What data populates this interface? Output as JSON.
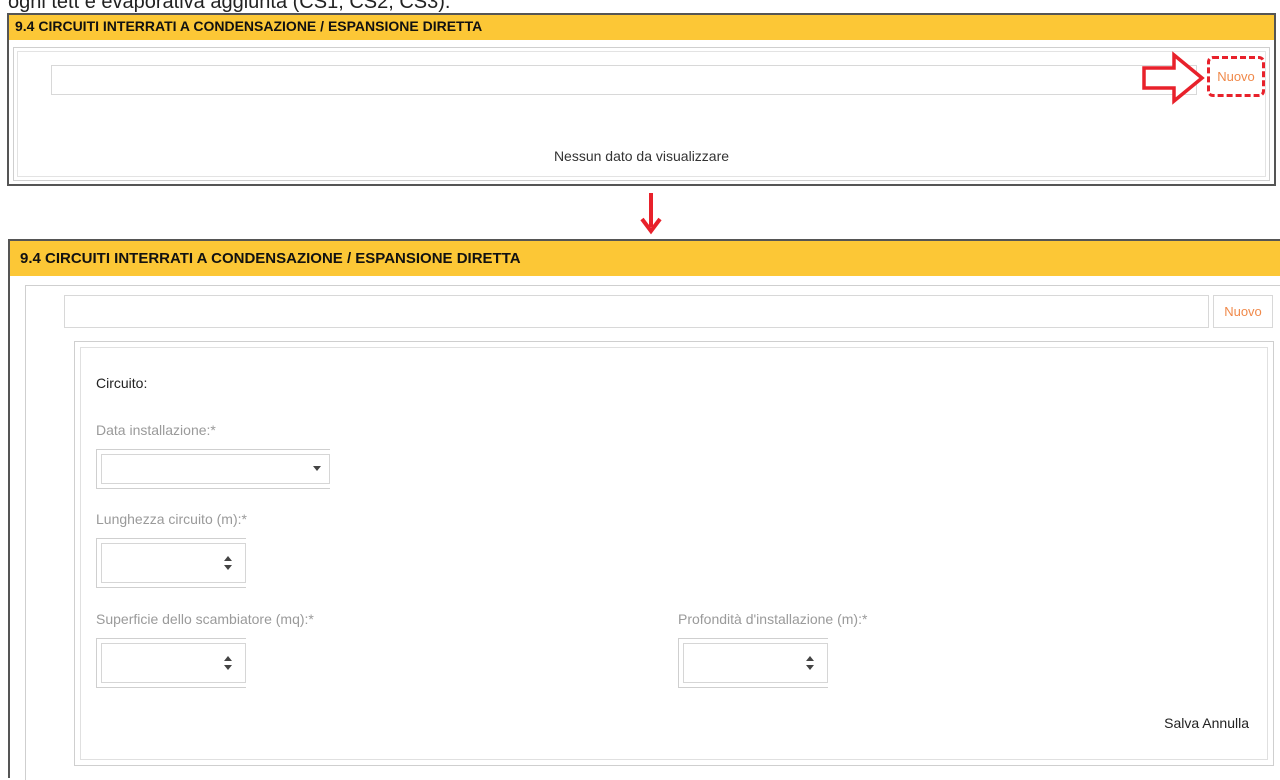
{
  "top_caption": "ogni tett e evaporativa aggiunta (CS1, CS2, CS3).",
  "panel_before": {
    "title": "9.4 CIRCUITI INTERRATI A CONDENSAZIONE / ESPANSIONE DIRETTA",
    "new_button": "Nuovo",
    "empty_message": "Nessun dato da visualizzare"
  },
  "panel_after": {
    "title": "9.4 CIRCUITI INTERRATI A CONDENSAZIONE / ESPANSIONE DIRETTA",
    "new_button": "Nuovo",
    "form": {
      "section_label": "Circuito:",
      "data_installazione": {
        "label": "Data installazione:*",
        "value": ""
      },
      "lunghezza_circuito": {
        "label": "Lunghezza circuito (m):*",
        "value": ""
      },
      "superficie_scambiatore": {
        "label": "Superficie dello scambiatore (mq):*",
        "value": ""
      },
      "profondita_installazione": {
        "label": "Profondità d'installazione (m):*",
        "value": ""
      },
      "save_label": "Salva",
      "cancel_label": "Annulla"
    }
  },
  "annotation_colors": {
    "arrow": "#e8212b",
    "header_bg": "#fcc736",
    "link": "#f0894a"
  },
  "icons": [
    "arrow-right-icon",
    "arrow-down-icon",
    "dropdown-caret-icon",
    "spinner-icon"
  ]
}
